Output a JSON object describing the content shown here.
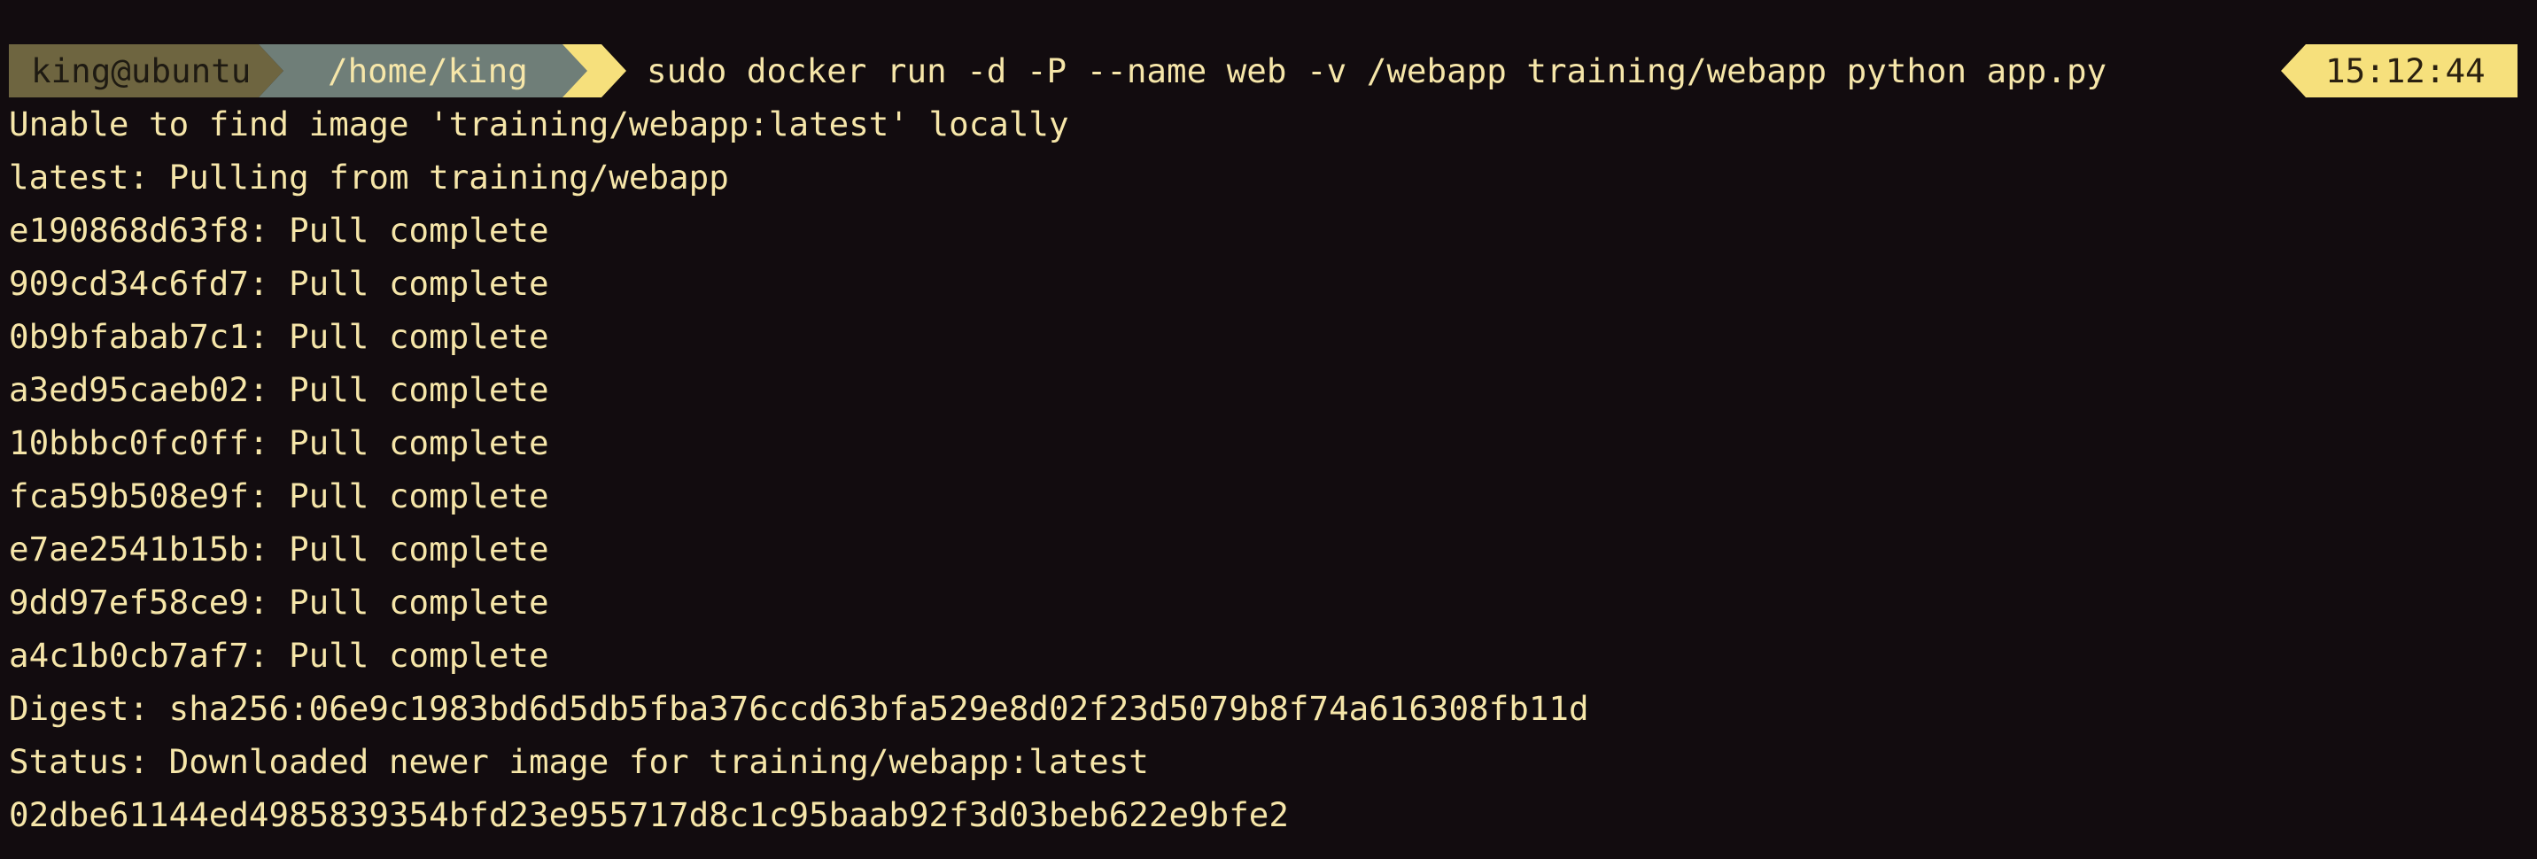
{
  "prompt": {
    "user_host": "king@ubuntu",
    "cwd": "/home/king",
    "command": "sudo docker run -d -P --name web -v /webapp training/webapp python app.py",
    "time": "15:12:44"
  },
  "output_lines": [
    "Unable to find image 'training/webapp:latest' locally",
    "latest: Pulling from training/webapp",
    "e190868d63f8: Pull complete",
    "909cd34c6fd7: Pull complete",
    "0b9bfabab7c1: Pull complete",
    "a3ed95caeb02: Pull complete",
    "10bbbc0fc0ff: Pull complete",
    "fca59b508e9f: Pull complete",
    "e7ae2541b15b: Pull complete",
    "9dd97ef58ce9: Pull complete",
    "a4c1b0cb7af7: Pull complete",
    "Digest: sha256:06e9c1983bd6d5db5fba376ccd63bfa529e8d02f23d5079b8f74a616308fb11d",
    "Status: Downloaded newer image for training/webapp:latest",
    "02dbe61144ed4985839354bfd23e955717d8c1c95baab92f3d03beb622e9bfe2"
  ],
  "colors": {
    "background": "#120c0f",
    "foreground": "#f6e6a9",
    "user_segment": "#6e6540",
    "dir_segment": "#6f7e78",
    "accent": "#f6e07c"
  }
}
